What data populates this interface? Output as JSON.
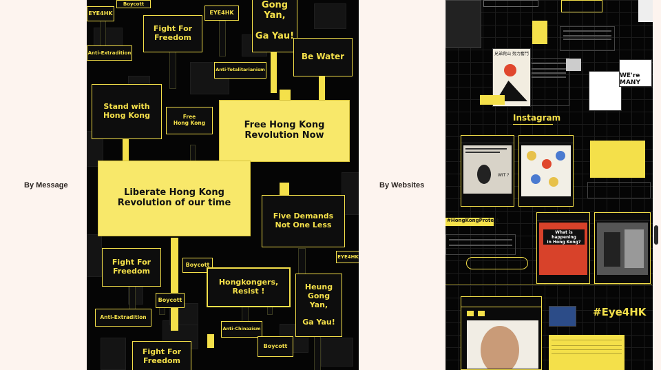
{
  "labels": {
    "left": "By Message",
    "right": "By Websites"
  },
  "signs": {
    "boycott_top": "Boycott",
    "eye4hk_left": "EYE4HK",
    "fight_freedom_top": "Fight For\nFreedom",
    "eye4hk_mid": "EYE4HK",
    "gong_yan_top": "Gong\nYan,\n\nGa Yau!",
    "be_water": "Be Water",
    "anti_extradition_top": "Anti-Extradition",
    "anti_totalitarianism": "Anti-Totalitarianism",
    "stand_with_hk": "Stand with\nHong Kong",
    "free_hk_small": "Free\nHong Kong",
    "free_hk_revolution": "Free Hong Kong\nRevolution Now",
    "liberate_hk": "Liberate Hong Kong\nRevolution of our time",
    "five_demands": "Five Demands\nNot One Less",
    "eye4hk_right": "EYE4HK",
    "fight_freedom_mid": "Fight For\nFreedom",
    "boycott_mid": "Boycott",
    "hongkongers_resist": "Hongkongers,\nResist !",
    "heung_gong": "Heung\nGong\nYan,\n\nGa Yau!",
    "boycott_low": "Boycott",
    "anti_extradition_low": "Anti-Extradition",
    "anti_chinazism": "Anti-Chinazism",
    "boycott_bottom": "Boycott",
    "fight_freedom_bottom": "Fight For\nFreedom"
  },
  "collage": {
    "instagram": "Instagram",
    "hashtag_protest": "#HongKongProtest",
    "what_happening": "What is happening\nin Hong Kong?",
    "eye4hk": "#Eye4HK",
    "poster_cn": "兄弟爬山 努力奮鬥",
    "were_many": "WE're MANY",
    "wit": "WIT ?"
  },
  "colors": {
    "accent": "#f4e04a",
    "bg": "#050505",
    "page": "#fdf4ef"
  }
}
